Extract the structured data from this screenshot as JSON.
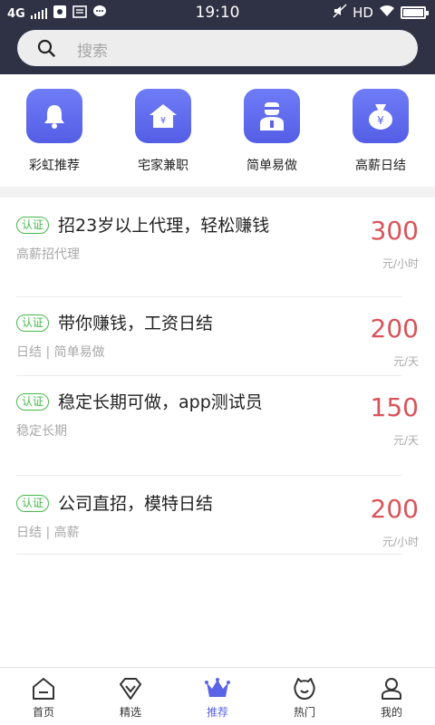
{
  "status_bar": {
    "network": "4G",
    "time": "19:10",
    "hd": "HD"
  },
  "search": {
    "placeholder": "搜索"
  },
  "categories": [
    {
      "label": "彩虹推荐",
      "icon": "bell-icon"
    },
    {
      "label": "宅家兼职",
      "icon": "house-icon"
    },
    {
      "label": "简单易做",
      "icon": "person-icon"
    },
    {
      "label": "高薪日结",
      "icon": "money-bag-icon"
    }
  ],
  "jobs": [
    {
      "badge": "认证",
      "title": "招23岁以上代理，轻松赚钱",
      "tags": "高薪招代理",
      "price": "300",
      "unit": "元/小时"
    },
    {
      "badge": "认证",
      "title": "带你赚钱，工资日结",
      "tags": "日结 | 简单易做",
      "price": "200",
      "unit": "元/天"
    },
    {
      "badge": "认证",
      "title": "稳定长期可做，app测试员",
      "tags": "稳定长期",
      "price": "150",
      "unit": "元/天"
    },
    {
      "badge": "认证",
      "title": "公司直招，模特日结",
      "tags": "日结 | 高薪",
      "price": "200",
      "unit": "元/小时"
    }
  ],
  "bottom_nav": [
    {
      "label": "首页",
      "icon": "home-icon"
    },
    {
      "label": "精选",
      "icon": "diamond-icon"
    },
    {
      "label": "推荐",
      "icon": "crown-icon",
      "active": true
    },
    {
      "label": "热门",
      "icon": "hot-icon"
    },
    {
      "label": "我的",
      "icon": "profile-icon"
    }
  ],
  "colors": {
    "header_bg": "#2f3144",
    "accent": "#5b63e6",
    "price": "#d9535a",
    "badge": "#46b84a"
  }
}
